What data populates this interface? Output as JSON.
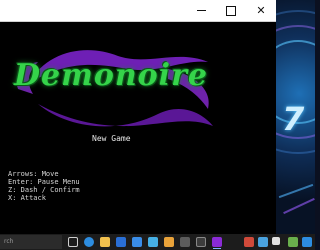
{
  "window": {
    "minimize_icon": "minimize-icon",
    "maximize_icon": "maximize-icon",
    "close_icon": "close-icon",
    "close_glyph": "✕"
  },
  "game": {
    "logo_text": "Demonoire",
    "menu_item": "New Game",
    "controls": [
      "Arrows: Move",
      "Enter: Pause Menu",
      "Z: Dash / Confirm",
      "X: Attack"
    ]
  },
  "taskbar": {
    "search_placeholder": "rch",
    "icons": [
      "task-view-icon",
      "edge-icon",
      "file-explorer-icon",
      "store-icon",
      "mail-icon",
      "photos-icon",
      "terminal-icon",
      "calculator-icon",
      "app-icon",
      "game-icon"
    ]
  },
  "colors": {
    "logo_green": "#35d44a",
    "logo_purple": "#8a2bd6",
    "text": "#e6e6e6"
  }
}
